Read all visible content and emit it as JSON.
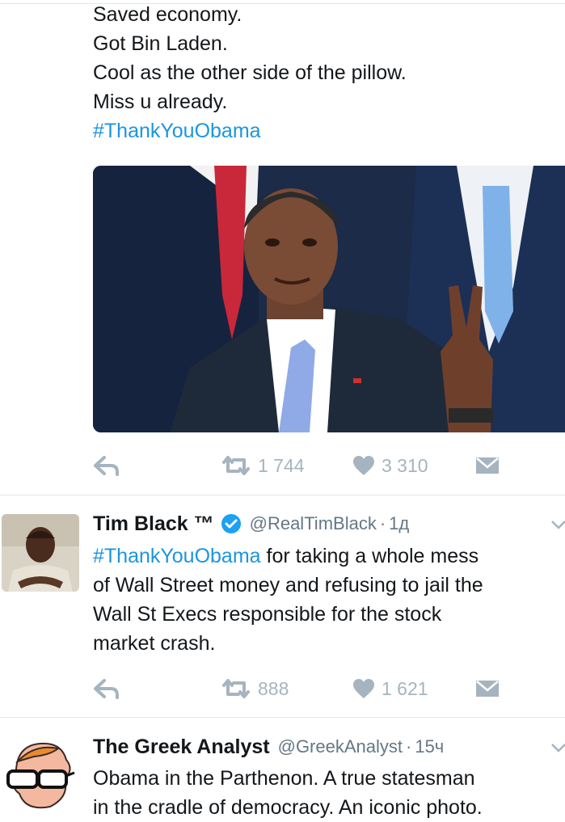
{
  "tweet1": {
    "lines": [
      "Saved economy.",
      "Got Bin Laden.",
      "Cool as the other side of the pillow.",
      "Miss u already."
    ],
    "hashtag": "#ThankYouObama",
    "retweets": "1 744",
    "likes": "3 310"
  },
  "tweet2": {
    "display_name": "Tim Black ™",
    "handle": "@RealTimBlack",
    "time": "1д",
    "hashtag": "#ThankYouObama",
    "text": [
      " for taking a whole mess",
      "of Wall Street money and refusing to jail the",
      "Wall St Execs responsible for the stock",
      "market crash."
    ],
    "retweets": "888",
    "likes": "1 621"
  },
  "tweet3": {
    "display_name": "The Greek Analyst",
    "handle": "@GreekAnalyst",
    "time": "15ч",
    "text": [
      "Obama in the Parthenon. A true statesman",
      "in the cradle of democracy. An iconic photo."
    ]
  },
  "icons": [
    "reply-icon",
    "retweet-icon",
    "like-icon",
    "direct-message-icon",
    "verified-icon",
    "chevron-down-icon"
  ],
  "colors": {
    "link": "#1b95e0",
    "verified": "#1da1f2",
    "action": "#a6b4bf",
    "divider": "#e1e8ed",
    "meta": "#657786"
  }
}
